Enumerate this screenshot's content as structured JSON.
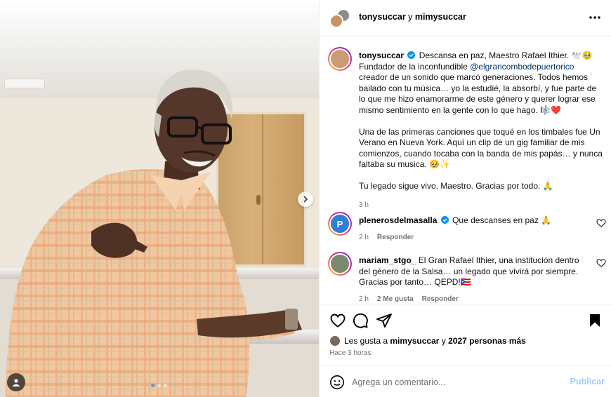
{
  "header": {
    "user1": "tonysuccar",
    "connector": " y ",
    "user2": "mimysuccar"
  },
  "caption": {
    "username": "tonysuccar",
    "line1": "Descansa en paz, Maestro Rafael Ithier. 🕊️🥹",
    "line2_pre": "Fundador de la inconfundible ",
    "mention": "@elgrancombodepuertorico",
    "line2_post": " creador de un sonido que marcó generaciones. Todos hemos bailado con tu música… yo la estudié, la absorbí, y fue parte de lo que me hizo enamorarme de este género y querer lograr ese mismo sentimiento en la gente con lo que hago. 🎼❤️",
    "paragraph2": "Una de las primeras canciones que toqué en los timbales fue Un Verano en Nueva York. Aquí un clip de un gig familiar de mis comienzos, cuando tocaba con la banda de mis papás… y nunca faltaba su musica. 🥹✨",
    "paragraph3": "Tu legado sigue vivo, Maestro. Gracias por todo. 🙏",
    "time": "3 h"
  },
  "comments": [
    {
      "username": "plenerosdelmasalla",
      "text": "Que descanses en paz 🙏",
      "time": "2 h",
      "reply_label": "Responder",
      "likes_label": ""
    },
    {
      "username": "mariam_stgo_",
      "text": "El Gran Rafael Ithier, una institución dentro del género de la Salsa… un legado que vivirá por siempre. Gracias por tanto… QEPD!🇵🇷",
      "time": "2 h",
      "likes_label": "2 Me gusta",
      "reply_label": "Responder"
    }
  ],
  "likes": {
    "prefix": "Les gusta a ",
    "user": "mimysuccar",
    "middle": " y ",
    "count": "2027 personas más"
  },
  "posted_ago": "Hace 3 horas",
  "comment_box": {
    "placeholder": "Agrega un comentario...",
    "publish_label": "Publicar"
  },
  "colors": {
    "link": "#00376b",
    "publish_disabled": "#a7c9f7",
    "verified": "#0095f6",
    "muted": "#737373"
  },
  "icons": [
    "more-options-icon",
    "verified-badge-icon",
    "heart-icon",
    "comment-icon",
    "share-icon",
    "bookmark-icon",
    "emoji-icon",
    "chevron-right-icon",
    "user-tag-icon"
  ]
}
